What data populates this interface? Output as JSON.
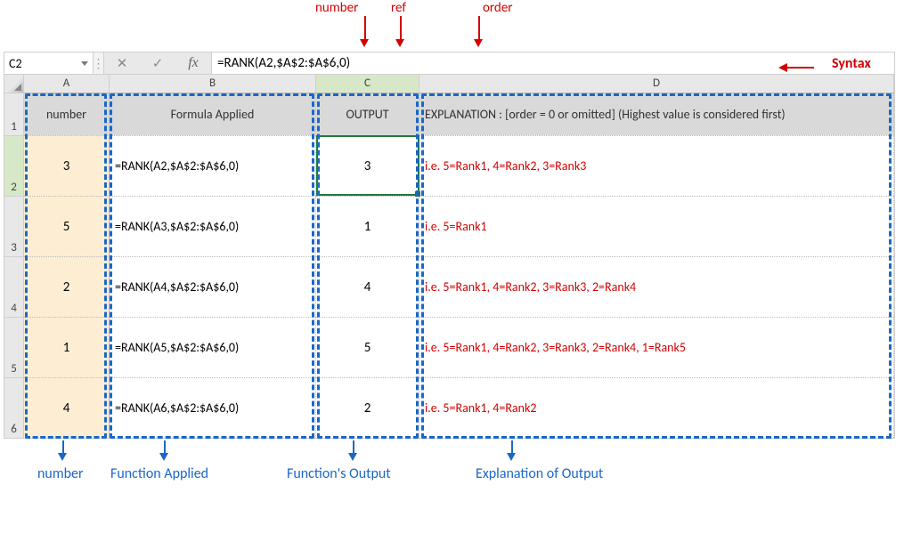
{
  "annotations_top": {
    "number": "number",
    "ref": "ref",
    "order": "order"
  },
  "syntax_label": "Syntax",
  "name_box": "C2",
  "fx_label": "fx",
  "formula_bar": "=RANK(A2,$A$2:$A$6,0)",
  "column_headers": {
    "A": "A",
    "B": "B",
    "C": "C",
    "D": "D"
  },
  "row_numbers": [
    "1",
    "2",
    "3",
    "4",
    "5",
    "6"
  ],
  "headers": {
    "A": "number",
    "B": "Formula Applied",
    "C": "OUTPUT",
    "D": "EXPLANATION : [order = 0 or omitted] (Highest value is considered first)"
  },
  "rows": [
    {
      "number": "3",
      "formula": "=RANK(A2,$A$2:$A$6,0)",
      "output": "3",
      "explain": "i.e. 5=Rank1, 4=Rank2, 3=Rank3"
    },
    {
      "number": "5",
      "formula": "=RANK(A3,$A$2:$A$6,0)",
      "output": "1",
      "explain": "i.e. 5=Rank1"
    },
    {
      "number": "2",
      "formula": "=RANK(A4,$A$2:$A$6,0)",
      "output": "4",
      "explain": "i.e. 5=Rank1, 4=Rank2, 3=Rank3, 2=Rank4"
    },
    {
      "number": "1",
      "formula": "=RANK(A5,$A$2:$A$6,0)",
      "output": "5",
      "explain": "i.e. 5=Rank1, 4=Rank2, 3=Rank3, 2=Rank4, 1=Rank5"
    },
    {
      "number": "4",
      "formula": "=RANK(A6,$A$2:$A$6,0)",
      "output": "2",
      "explain": "i.e. 5=Rank1, 4=Rank2"
    }
  ],
  "annotations_bottom": {
    "number": "number",
    "function_applied": "Function Applied",
    "functions_output": "Function's Output",
    "explanation": "Explanation of Output"
  }
}
